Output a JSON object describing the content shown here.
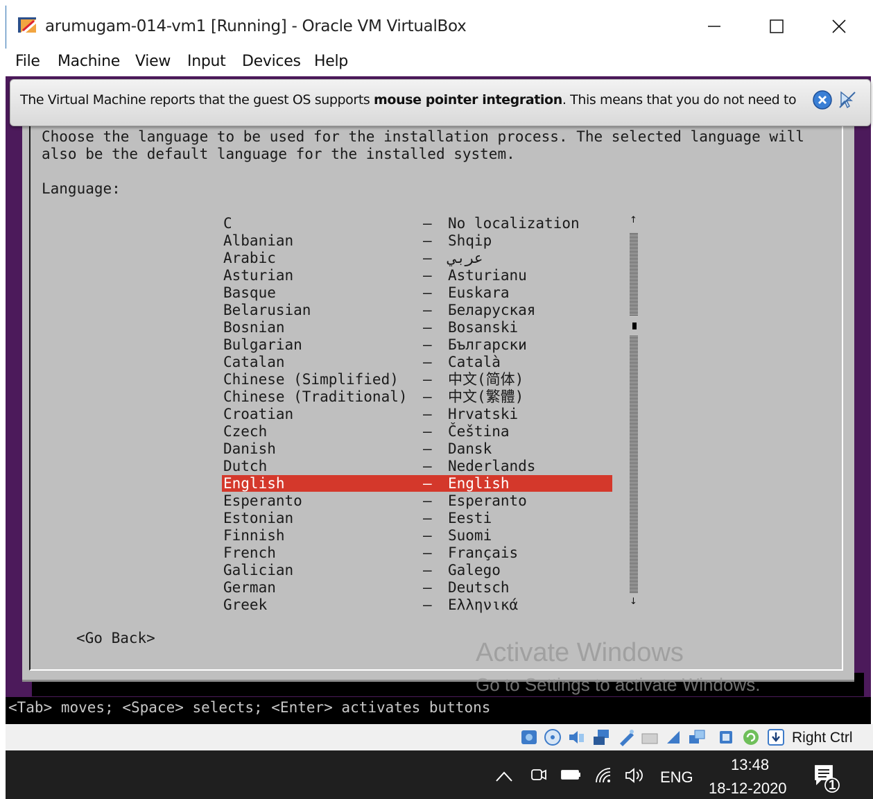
{
  "window": {
    "title": "arumugam-014-vm1 [Running] - Oracle VM VirtualBox",
    "controls": [
      "minimize",
      "maximize",
      "close"
    ]
  },
  "menu": {
    "items": [
      "File",
      "Machine",
      "View",
      "Input",
      "Devices",
      "Help"
    ]
  },
  "notification": {
    "text_before": "The Virtual Machine reports that the guest OS supports ",
    "text_bold": "mouse pointer integration",
    "text_after": ". This means that you do not need to",
    "icons": [
      "close-notification-icon",
      "mouse-integration-icon"
    ]
  },
  "installer": {
    "intro_line1": "Choose the language to be used for the installation process. The selected language will",
    "intro_line2": "also be the default language for the installed system.",
    "language_label": "Language:",
    "dash": "–",
    "languages": [
      {
        "name": "C",
        "native": "No localization"
      },
      {
        "name": "Albanian",
        "native": "Shqip"
      },
      {
        "name": "Arabic",
        "native": "عربي"
      },
      {
        "name": "Asturian",
        "native": "Asturianu"
      },
      {
        "name": "Basque",
        "native": "Euskara"
      },
      {
        "name": "Belarusian",
        "native": "Беларуская"
      },
      {
        "name": "Bosnian",
        "native": "Bosanski"
      },
      {
        "name": "Bulgarian",
        "native": "Български"
      },
      {
        "name": "Catalan",
        "native": "Català"
      },
      {
        "name": "Chinese (Simplified)",
        "native": "中文(简体)"
      },
      {
        "name": "Chinese (Traditional)",
        "native": "中文(繁體)"
      },
      {
        "name": "Croatian",
        "native": "Hrvatski"
      },
      {
        "name": "Czech",
        "native": "Čeština"
      },
      {
        "name": "Danish",
        "native": "Dansk"
      },
      {
        "name": "Dutch",
        "native": "Nederlands"
      },
      {
        "name": "English",
        "native": "English",
        "selected": true
      },
      {
        "name": "Esperanto",
        "native": "Esperanto"
      },
      {
        "name": "Estonian",
        "native": "Eesti"
      },
      {
        "name": "Finnish",
        "native": "Suomi"
      },
      {
        "name": "French",
        "native": "Français"
      },
      {
        "name": "Galician",
        "native": "Galego"
      },
      {
        "name": "German",
        "native": "Deutsch"
      },
      {
        "name": "Greek",
        "native": "Ελληνικά"
      }
    ],
    "go_back": "<Go Back>",
    "help_line": "<Tab> moves; <Space> selects; <Enter> activates buttons",
    "highlight_color": "#d4382b"
  },
  "watermark": {
    "title": "Activate Windows",
    "subtitle": "Go to Settings to activate Windows."
  },
  "statusbar": {
    "icons": [
      "hard-disk-icon",
      "optical-drive-icon",
      "audio-icon",
      "network-icon",
      "usb-icon",
      "shared-folders-icon",
      "display-icon",
      "recording-icon",
      "cpu-icon",
      "mouse-integration-icon",
      "keyboard-icon"
    ],
    "host_key": "Right Ctrl"
  },
  "taskbar": {
    "language": "ENG",
    "time": "13:48",
    "date": "18-12-2020",
    "notification_count": "1"
  }
}
